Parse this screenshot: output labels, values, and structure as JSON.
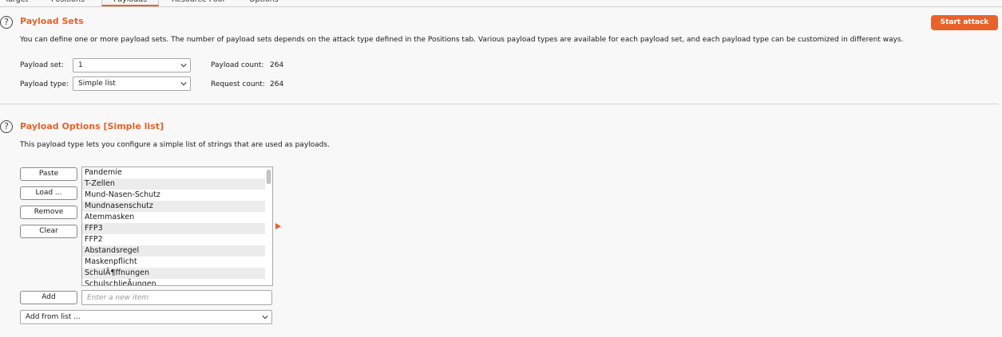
{
  "tabs": [
    {
      "label": "Target"
    },
    {
      "label": "Positions"
    },
    {
      "label": "Payloads"
    },
    {
      "label": "Resource Pool"
    },
    {
      "label": "Options"
    }
  ],
  "payload_sets": {
    "help_icon": "?",
    "title": "Payload Sets",
    "description": "You can define one or more payload sets. The number of payload sets depends on the attack type defined in the Positions tab. Various payload types are available for each payload set, and each payload type can be customized in different ways.",
    "start_attack_label": "Start attack",
    "payload_set_label": "Payload set:",
    "payload_set_value": "1",
    "payload_type_label": "Payload type:",
    "payload_type_value": "Simple list",
    "payload_count_label": "Payload count:",
    "payload_count_value": "264",
    "request_count_label": "Request count:",
    "request_count_value": "264"
  },
  "payload_options": {
    "help_icon": "?",
    "title": "Payload Options [Simple list]",
    "description": "This payload type lets you configure a simple list of strings that are used as payloads.",
    "paste_label": "Paste",
    "load_label": "Load ...",
    "remove_label": "Remove",
    "clear_label": "Clear",
    "items": [
      "Pandemie",
      "T-Zellen",
      "Mund-Nasen-Schutz",
      "Mundnasenschutz",
      "Atemmasken",
      "FFP3",
      "FFP2",
      "Abstandsregel",
      "Maskenpflicht",
      "SchulÃ¶ffnungen",
      "SchulschlieÃungen"
    ],
    "add_label": "Add",
    "new_item_placeholder": "Enter a new item",
    "add_from_list_label": "Add from list ..."
  },
  "icons": {
    "dropdown": "chevron-down-icon",
    "help": "help-circle-icon",
    "insert_marker": "triangle-right-icon"
  },
  "colors": {
    "accent": "#e8622a",
    "background": "#f8f8f8",
    "alt_row": "#ececec"
  }
}
